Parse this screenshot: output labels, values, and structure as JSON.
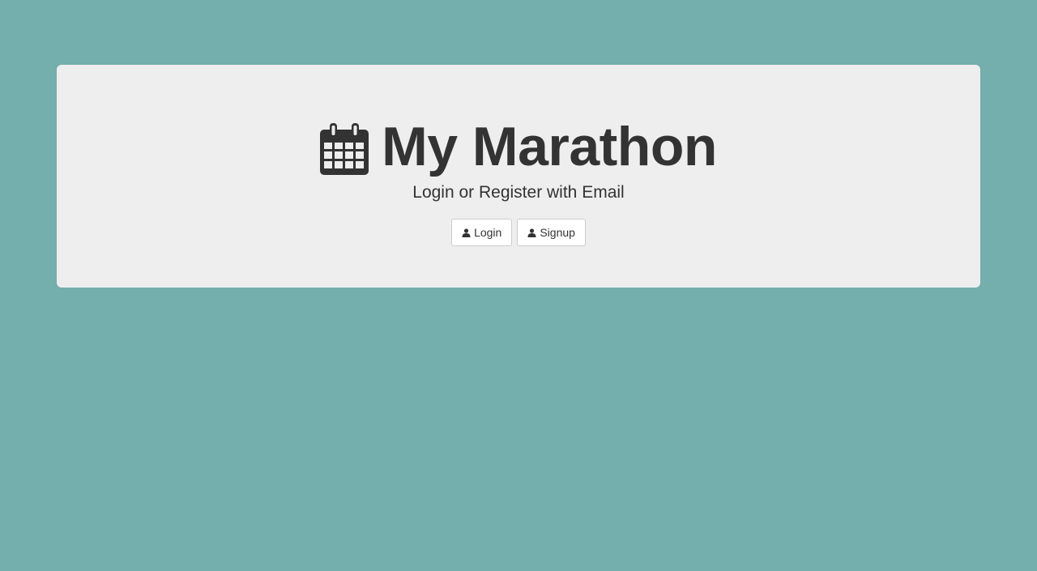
{
  "header": {
    "icon": "calendar-icon",
    "title": "My Marathon",
    "subtitle": "Login or Register with Email"
  },
  "actions": {
    "login_label": "Login",
    "login_icon": "user-icon",
    "signup_label": "Signup",
    "signup_icon": "user-icon"
  },
  "colors": {
    "background": "#74aead",
    "panel": "#eeeeee",
    "text": "#333333",
    "button_border": "#cccccc"
  }
}
